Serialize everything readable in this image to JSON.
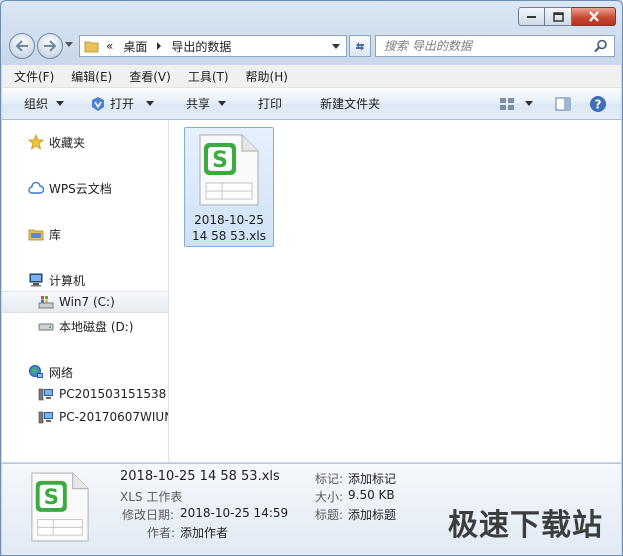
{
  "window": {
    "caption_buttons": [
      "minimize",
      "maximize",
      "close"
    ]
  },
  "address": {
    "prefix": "«",
    "crumbs": [
      "桌面",
      "导出的数据"
    ]
  },
  "search": {
    "placeholder": "搜索 导出的数据"
  },
  "menu": [
    "文件(F)",
    "编辑(E)",
    "查看(V)",
    "工具(T)",
    "帮助(H)"
  ],
  "toolbar": {
    "organize": "组织",
    "open": "打开",
    "share": "共享",
    "print": "打印",
    "new_folder": "新建文件夹"
  },
  "sidebar": {
    "favorites": "收藏夹",
    "wps_cloud": "WPS云文档",
    "libraries": "库",
    "computer": "计算机",
    "drive_c": "Win7 (C:)",
    "drive_d": "本地磁盘 (D:)",
    "network": "网络",
    "pc1": "PC201503151538",
    "pc2": "PC-20170607WIUN"
  },
  "file": {
    "name_line1": "2018-10-25",
    "name_line2": "14 58 53.xls"
  },
  "details": {
    "filename": "2018-10-25 14 58 53.xls",
    "type": "XLS 工作表",
    "modified_label": "修改日期:",
    "modified_value": "2018-10-25 14:59",
    "author_label": "作者:",
    "author_value": "添加作者",
    "tags_label": "标记:",
    "tags_value": "添加标记",
    "size_label": "大小:",
    "size_value": "9.50 KB",
    "title_label": "标题:",
    "title_value": "添加标题"
  },
  "watermark": "极速下载站",
  "colors": {
    "wps_green": "#3bab3f",
    "selection": "#cfe2f8",
    "titlebar": "#dbe7f4"
  }
}
